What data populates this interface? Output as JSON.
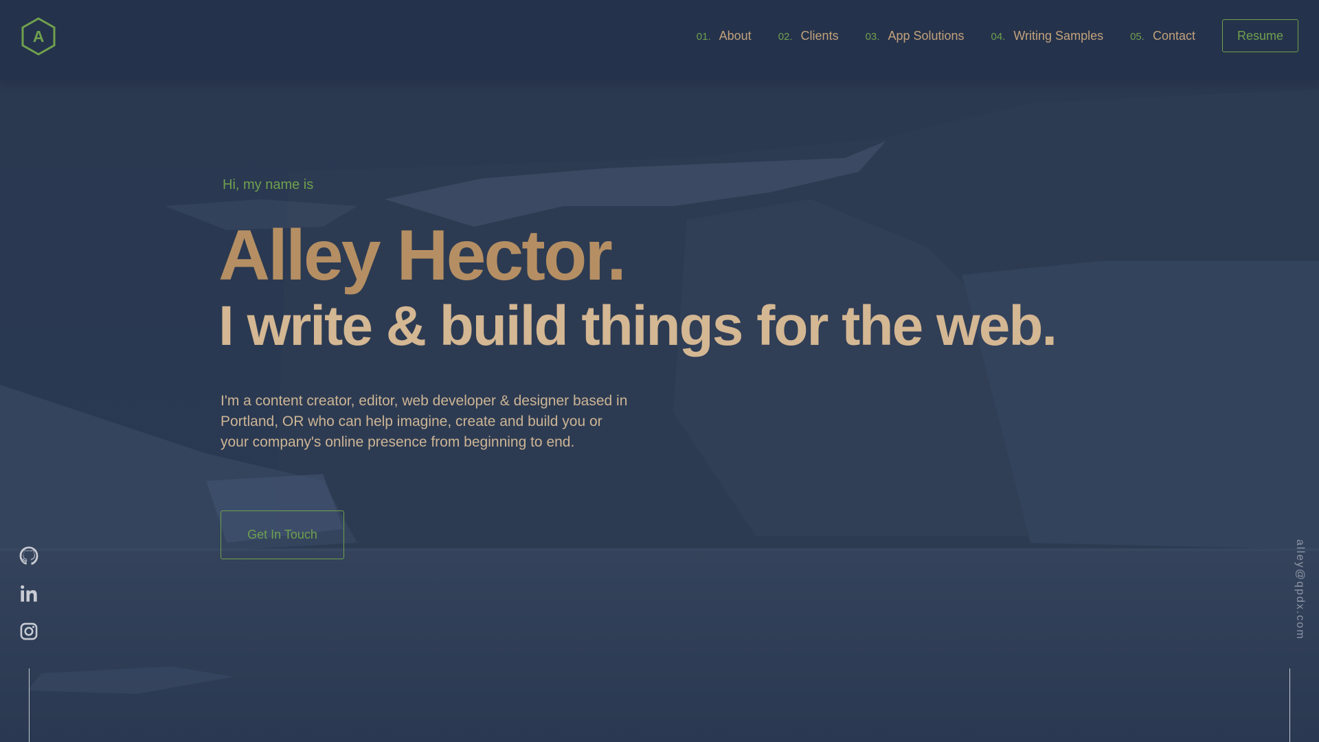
{
  "logo": {
    "letter": "A"
  },
  "nav": {
    "items": [
      {
        "num": "01.",
        "label": "About"
      },
      {
        "num": "02.",
        "label": "Clients"
      },
      {
        "num": "03.",
        "label": "App Solutions"
      },
      {
        "num": "04.",
        "label": "Writing Samples"
      },
      {
        "num": "05.",
        "label": "Contact"
      }
    ],
    "resume_label": "Resume"
  },
  "hero": {
    "greeting": "Hi, my name is",
    "name": "Alley Hector.",
    "tagline": "I write & build things for the web.",
    "bio": "I'm a content creator, editor, web developer & designer based in Portland, OR who can help imagine, create and build you or your company's online presence from beginning to end.",
    "cta_label": "Get In Touch"
  },
  "social": [
    {
      "icon": "github-icon"
    },
    {
      "icon": "linkedin-icon"
    },
    {
      "icon": "instagram-icon"
    }
  ],
  "email": "alley@qpdx.com",
  "colors": {
    "background": "#26354e",
    "accent_green": "#6fa14e",
    "name_tan": "#b58f63",
    "tagline_tan": "#d4b793"
  }
}
